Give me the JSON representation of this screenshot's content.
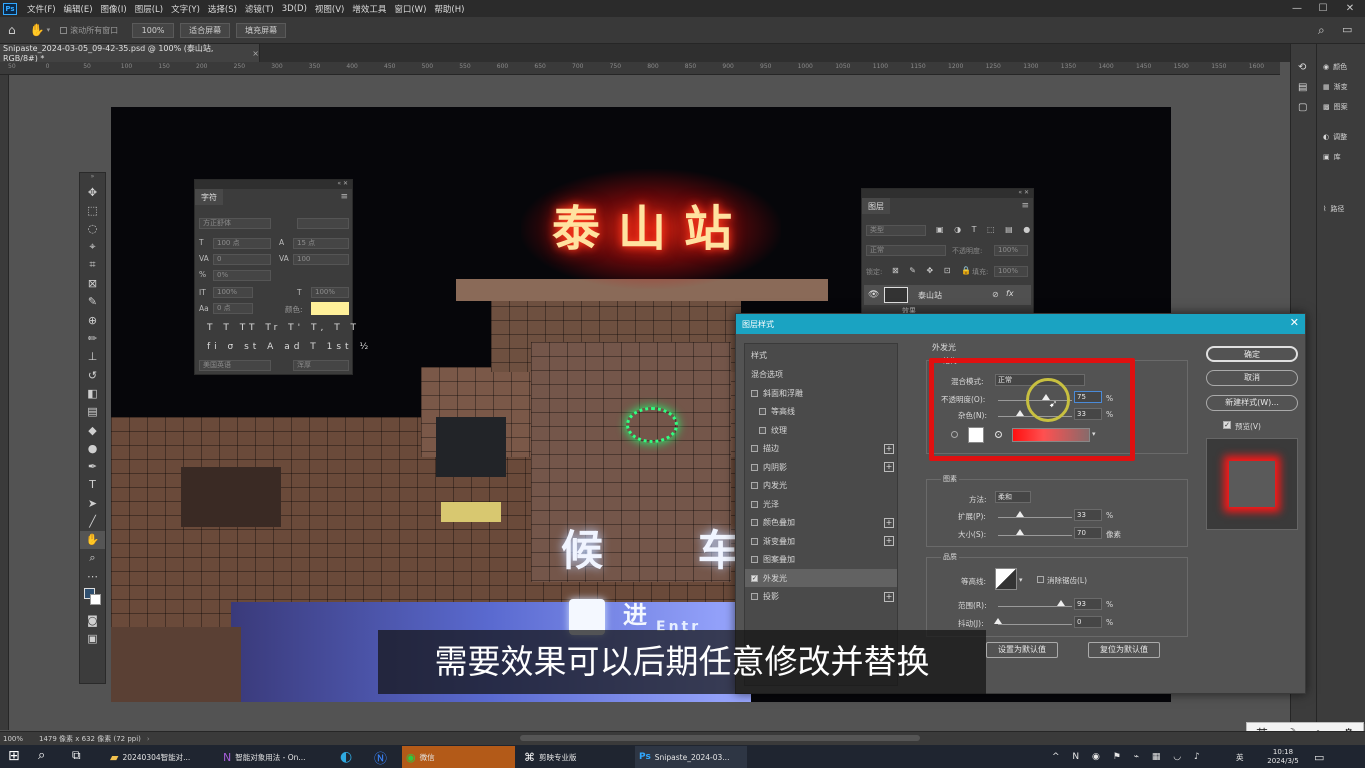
{
  "menubar": {
    "logo": "Ps",
    "items": [
      "文件(F)",
      "编辑(E)",
      "图像(I)",
      "图层(L)",
      "文字(Y)",
      "选择(S)",
      "滤镜(T)",
      "3D(D)",
      "视图(V)",
      "增效工具",
      "窗口(W)",
      "帮助(H)"
    ],
    "minimize": "—",
    "maximize": "☐",
    "close": "✕"
  },
  "optbar": {
    "scroll_all": "滚动所有窗口",
    "zoom": "100%",
    "fit_screen": "适合屏幕",
    "fill_screen": "填充屏幕"
  },
  "doc_tab": {
    "title": "Snipaste_2024-03-05_09-42-35.psd @ 100% (泰山站, RGB/8#) *",
    "close": "×"
  },
  "ruler_ticks": [
    "50",
    "0",
    "50",
    "100",
    "150",
    "200",
    "250",
    "300",
    "350",
    "400",
    "450",
    "500",
    "550",
    "600",
    "650",
    "700",
    "750",
    "800",
    "850",
    "900",
    "950",
    "1000",
    "1050",
    "1100",
    "1150",
    "1200",
    "1250",
    "1300",
    "1350",
    "1400",
    "1450",
    "1500",
    "1550",
    "1600"
  ],
  "photo": {
    "sign_text": "泰山站",
    "wait_text": "候 车",
    "entrance_text": "进 站",
    "entrance_en": "Entr"
  },
  "char_panel": {
    "tab": "字符",
    "font_family": "方正舒体",
    "font_size": "100 点",
    "leading": "15 点",
    "kerning": "0",
    "tracking": "100",
    "scale_pct": "0%",
    "vscale": "100%",
    "hscale": "100%",
    "baseline": "0 点",
    "color_label": "颜色:",
    "language": "美国英语",
    "aa_label": "浑厚",
    "color": "#fff09a"
  },
  "layers_panel": {
    "tab": "图层",
    "kind_label": "类型",
    "blend": "正常",
    "opacity_label": "不透明度:",
    "opacity": "100%",
    "lock_label": "锁定:",
    "fill_label": "填充:",
    "fill": "100%",
    "layer_name": "泰山站",
    "sub_effect": "效果",
    "fx": "fx"
  },
  "right_dock": {
    "items": [
      "颜色",
      "渐变",
      "图案",
      "调整",
      "库",
      "路径"
    ]
  },
  "dialog": {
    "title": "图层样式",
    "close": "✕",
    "styles_header": "样式",
    "blend_options": "混合选项",
    "style_items": [
      {
        "label": "斜面和浮雕",
        "checked": false,
        "plus": false
      },
      {
        "label": "等高线",
        "checked": false,
        "plus": false
      },
      {
        "label": "纹理",
        "checked": false,
        "plus": false
      },
      {
        "label": "描边",
        "checked": false,
        "plus": true
      },
      {
        "label": "内阴影",
        "checked": false,
        "plus": true
      },
      {
        "label": "内发光",
        "checked": false,
        "plus": false
      },
      {
        "label": "光泽",
        "checked": false,
        "plus": false
      },
      {
        "label": "颜色叠加",
        "checked": false,
        "plus": true
      },
      {
        "label": "渐变叠加",
        "checked": false,
        "plus": true
      },
      {
        "label": "图案叠加",
        "checked": false,
        "plus": false
      },
      {
        "label": "外发光",
        "checked": true,
        "plus": false
      },
      {
        "label": "投影",
        "checked": false,
        "plus": true
      }
    ],
    "section_title": "外发光",
    "structure": "结构",
    "blend_mode_label": "混合模式:",
    "blend_mode": "正常",
    "opacity_label": "不透明度(O):",
    "opacity": "75",
    "noise_label": "杂色(N):",
    "noise": "33",
    "pct": "%",
    "method_sub": "方法:",
    "elements": "图素",
    "technique_label": "方法:",
    "technique": "柔和",
    "spread_label": "扩展(P):",
    "spread": "33",
    "size_label": "大小(S):",
    "size": "70",
    "px": "像素",
    "quality": "品质",
    "contour_label": "等高线:",
    "antialias": "消除锯齿(L)",
    "range_label": "范围(R):",
    "range": "93",
    "jitter_label": "抖动(J):",
    "jitter": "0",
    "set_default": "设置为默认值",
    "reset_default": "复位为默认值",
    "ok": "确定",
    "cancel": "取消",
    "new_style": "新建样式(W)...",
    "preview": "预览(V)",
    "highlight_color": "#e01010"
  },
  "status": {
    "zoom": "100%",
    "info": "1479 像素 x 632 像素 (72 ppi)"
  },
  "taskbar": {
    "items": [
      "20240304智能对...",
      "智能对象用法 - On...",
      "微信",
      "剪映专业版",
      "Snipaste_2024-03..."
    ],
    "time": "10:18",
    "date": "2024/3/5",
    "lang": "英"
  },
  "subtitle": "需要效果可以后期任意修改并替换",
  "ime": {
    "lang": "英",
    "moon": "☽",
    "dot": "•,",
    "gear": "⚙"
  }
}
